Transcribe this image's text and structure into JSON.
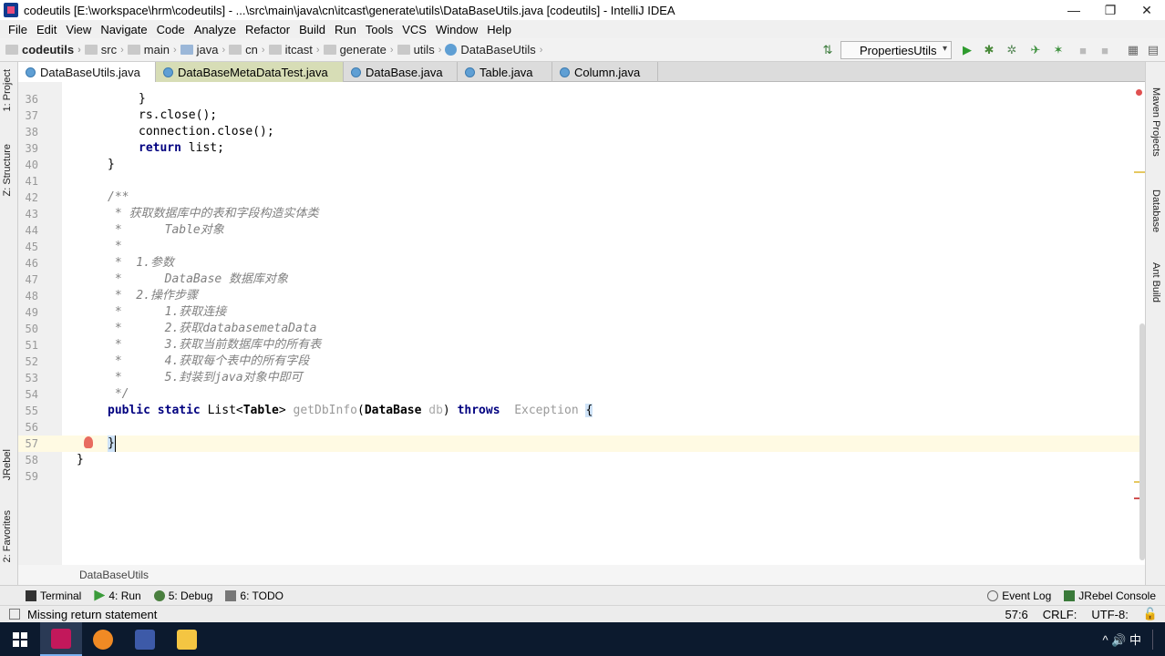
{
  "window": {
    "title": "codeutils [E:\\workspace\\hrm\\codeutils] - ...\\src\\main\\java\\cn\\itcast\\generate\\utils\\DataBaseUtils.java [codeutils] - IntelliJ IDEA",
    "minimize": "—",
    "restore": "❐",
    "close": "✕"
  },
  "menu": [
    "File",
    "Edit",
    "View",
    "Navigate",
    "Code",
    "Analyze",
    "Refactor",
    "Build",
    "Run",
    "Tools",
    "VCS",
    "Window",
    "Help"
  ],
  "breadcrumb": [
    "codeutils",
    "src",
    "main",
    "java",
    "cn",
    "itcast",
    "generate",
    "utils",
    "DataBaseUtils"
  ],
  "run_config": "PropertiesUtils",
  "tabs": [
    "DataBaseUtils.java",
    "DataBaseMetaDataTest.java",
    "DataBase.java",
    "Table.java",
    "Column.java"
  ],
  "left_tools": [
    "1: Project",
    "Z: Structure",
    "JRebel",
    "2: Favorites"
  ],
  "right_tools": [
    "Maven Projects",
    "Database",
    "Ant Build"
  ],
  "code": {
    "line_numbers": [
      "36",
      "37",
      "38",
      "39",
      "40",
      "41",
      "42",
      "43",
      "44",
      "45",
      "46",
      "47",
      "48",
      "49",
      "50",
      "51",
      "52",
      "53",
      "54",
      "55",
      "56",
      "57",
      "58",
      "59"
    ],
    "l36_a": "}",
    "l37_a": "rs.close",
    "l37_b": "();",
    "l38_a": "connection.close",
    "l38_b": "();",
    "l39_kw": "return",
    "l39_b": " list;",
    "l40": "}",
    "l42": "/**",
    "l43": " * 获取数据库中的表和字段构造实体类",
    "l44": " *      Table对象",
    "l45": " *",
    "l46": " *  1.参数",
    "l47": " *      DataBase 数据库对象",
    "l48": " *  2.操作步骤",
    "l49": " *      1.获取连接",
    "l50": " *      2.获取databasemetaData",
    "l51": " *      3.获取当前数据库中的所有表",
    "l52": " *      4.获取每个表中的所有字段",
    "l53": " *      5.封装到java对象中即可",
    "l54": " */",
    "l55_kw1": "public",
    "l55_kw2": "static",
    "l55_type": "List<",
    "l55_gen": "Table",
    "l55_type2": ">",
    "l55_fn": "getDbInfo",
    "l55_paren": "(",
    "l55_ptype": "DataBase",
    "l55_pname": "db",
    "l55_paren2": ")",
    "l55_throws": "throws",
    "l55_exc": "Exception",
    "l55_brace": "{",
    "l57": "}",
    "l58": "}"
  },
  "editor_breadcrumb": "DataBaseUtils",
  "tool_windows": [
    "Terminal",
    "4: Run",
    "5: Debug",
    "6: TODO"
  ],
  "tool_windows_right": [
    "Event Log",
    "JRebel Console"
  ],
  "status": {
    "message": "Missing return statement",
    "position": "57:6",
    "line_sep": "CRLF:",
    "encoding": "UTF-8:"
  },
  "taskbar": {
    "tray_text": "^ 🔊 中"
  }
}
